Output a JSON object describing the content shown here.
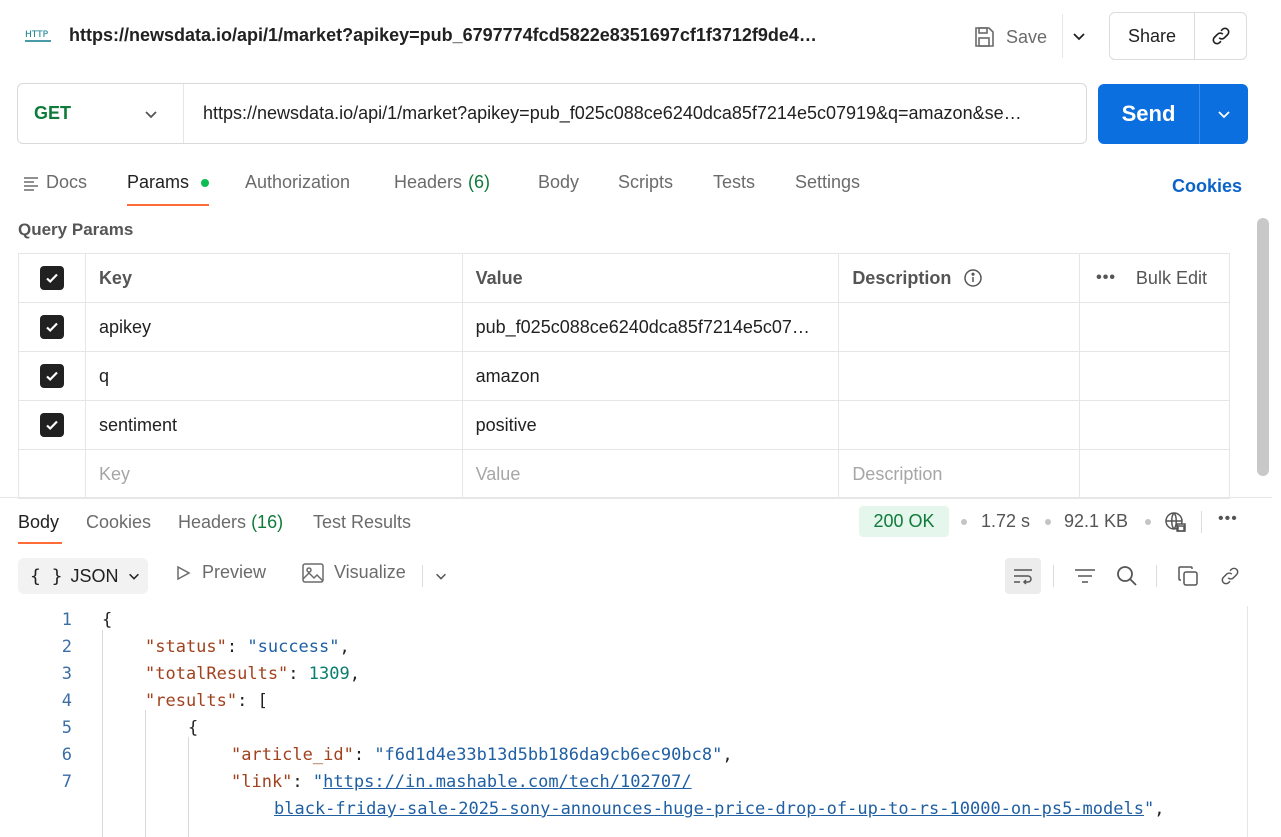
{
  "header": {
    "http_badge": "HTTP",
    "title": "https://newsdata.io/api/1/market?apikey=pub_6797774fcd5822e8351697cf1f3712f9de4…",
    "save_label": "Save",
    "share_label": "Share"
  },
  "request": {
    "method": "GET",
    "url": "https://newsdata.io/api/1/market?apikey=pub_f025c088ce6240dca85f7214e5c07919&q=amazon&se…",
    "send_label": "Send"
  },
  "tabs": {
    "docs": "Docs",
    "params": "Params",
    "authorization": "Authorization",
    "headers": "Headers",
    "headers_count": "(6)",
    "body": "Body",
    "scripts": "Scripts",
    "tests": "Tests",
    "settings": "Settings",
    "cookies": "Cookies"
  },
  "params": {
    "section_title": "Query Params",
    "columns": {
      "key": "Key",
      "value": "Value",
      "description": "Description",
      "bulk_edit": "Bulk Edit"
    },
    "rows": [
      {
        "key": "apikey",
        "value": "pub_f025c088ce6240dca85f7214e5c07…"
      },
      {
        "key": "q",
        "value": "amazon"
      },
      {
        "key": "sentiment",
        "value": "positive"
      }
    ],
    "placeholder": {
      "key": "Key",
      "value": "Value",
      "description": "Description"
    }
  },
  "response": {
    "tabs": {
      "body": "Body",
      "cookies": "Cookies",
      "headers": "Headers",
      "headers_count": "(16)",
      "test_results": "Test Results"
    },
    "status": "200 OK",
    "time": "1.72 s",
    "size": "92.1 KB",
    "format": "JSON",
    "preview": "Preview",
    "visualize": "Visualize"
  },
  "code": {
    "line_numbers": [
      "1",
      "2",
      "3",
      "4",
      "5",
      "6",
      "7"
    ],
    "open_brace": "{",
    "status_key": "\"status\"",
    "status_val": "\"success\"",
    "total_key": "\"totalResults\"",
    "total_val": "1309",
    "results_key": "\"results\"",
    "results_open": "[",
    "obj_open": "{",
    "article_key": "\"article_id\"",
    "article_val": "\"f6d1d4e33b13d5bb186da9cb6ec90bc8\"",
    "link_key": "\"link\"",
    "link_val_1": "https://in.mashable.com/tech/102707/",
    "link_val_2": "black-friday-sale-2025-sony-announces-huge-price-drop-of-up-to-rs-10000-on-ps5-models"
  }
}
